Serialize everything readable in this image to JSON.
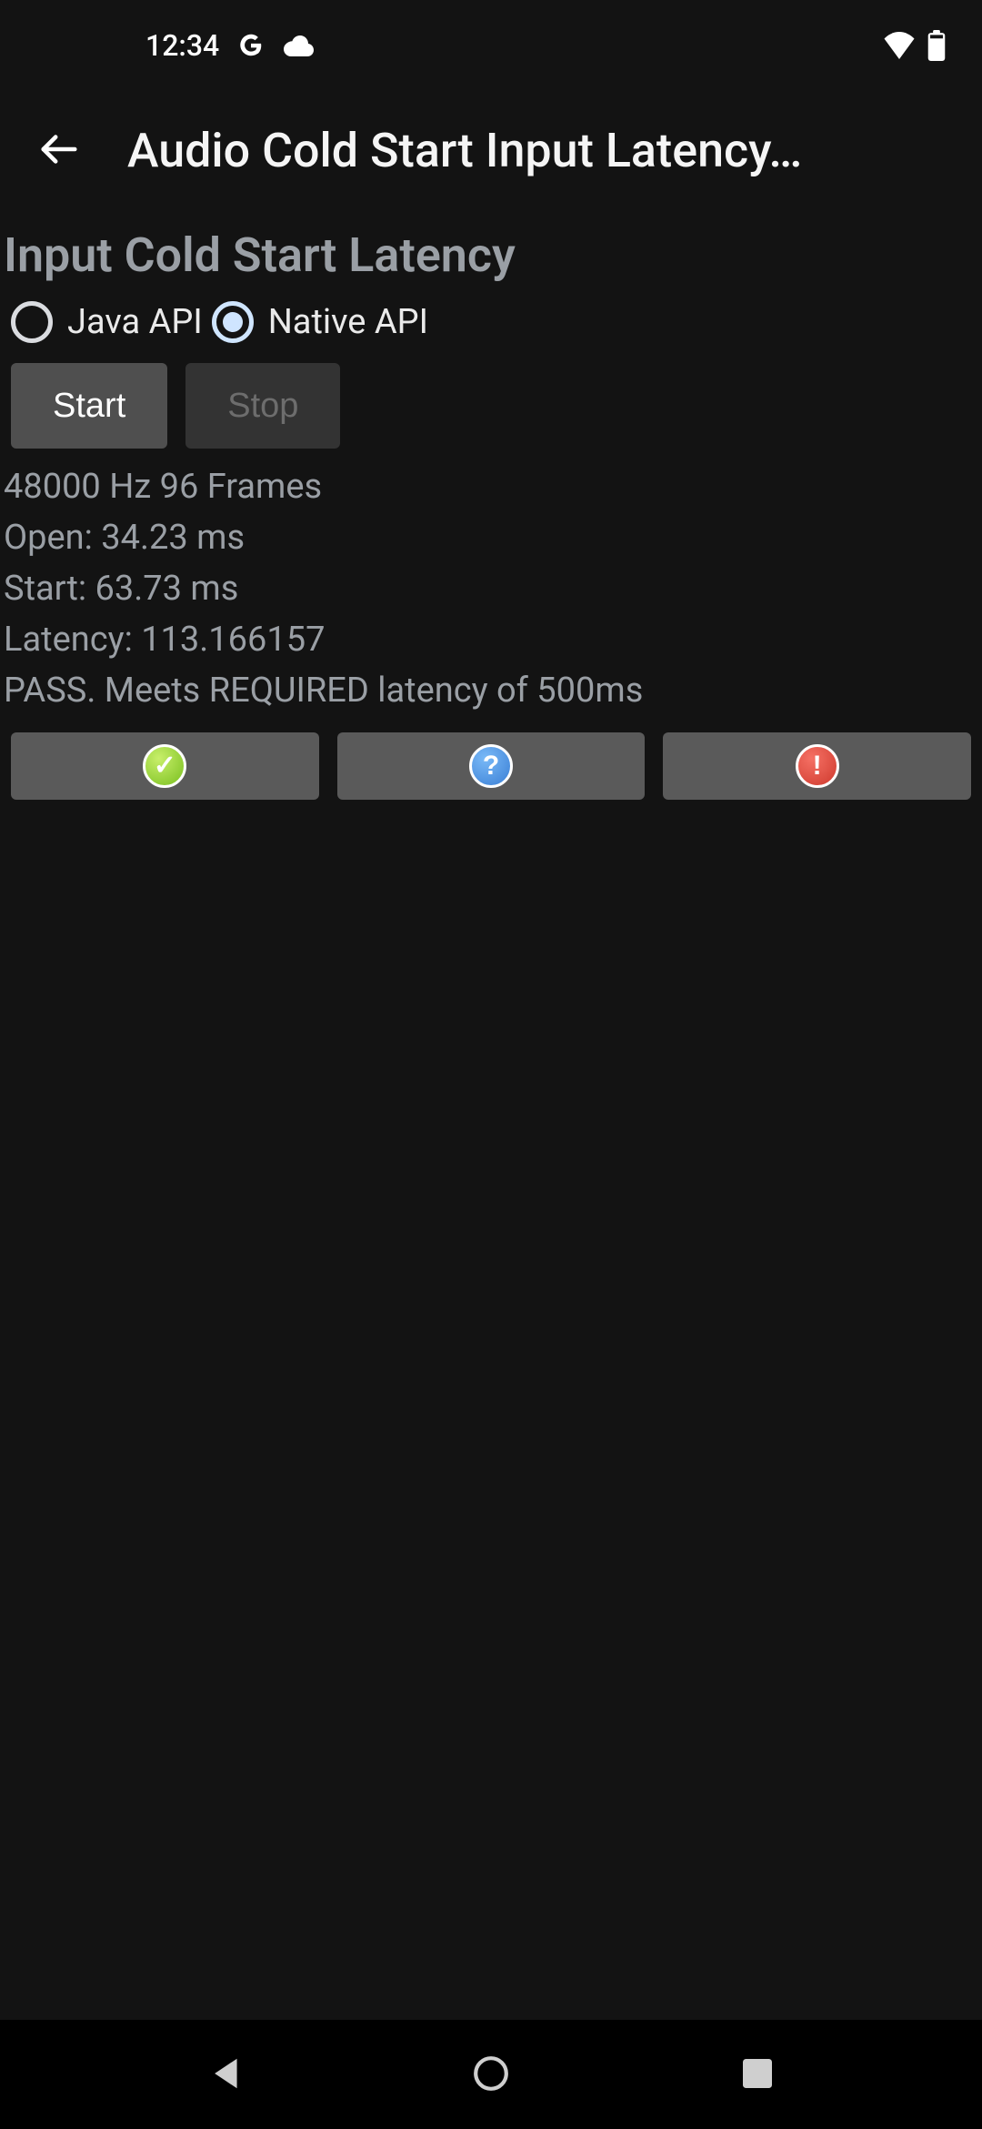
{
  "status": {
    "time": "12:34"
  },
  "appbar": {
    "title": "Audio Cold Start Input Latency…"
  },
  "section": {
    "title": "Input Cold Start Latency"
  },
  "radio": {
    "java_label": "Java API",
    "native_label": "Native API",
    "selected": "native"
  },
  "buttons": {
    "start": "Start",
    "stop": "Stop"
  },
  "results": {
    "line1": "48000 Hz 96 Frames",
    "line2": "Open: 34.23 ms",
    "line3": "Start: 63.73 ms",
    "line4": "Latency: 113.166157",
    "line5": "PASS. Meets REQUIRED latency of 500ms"
  },
  "result_buttons": {
    "pass_symbol": "✓",
    "help_symbol": "?",
    "fail_symbol": "!"
  }
}
